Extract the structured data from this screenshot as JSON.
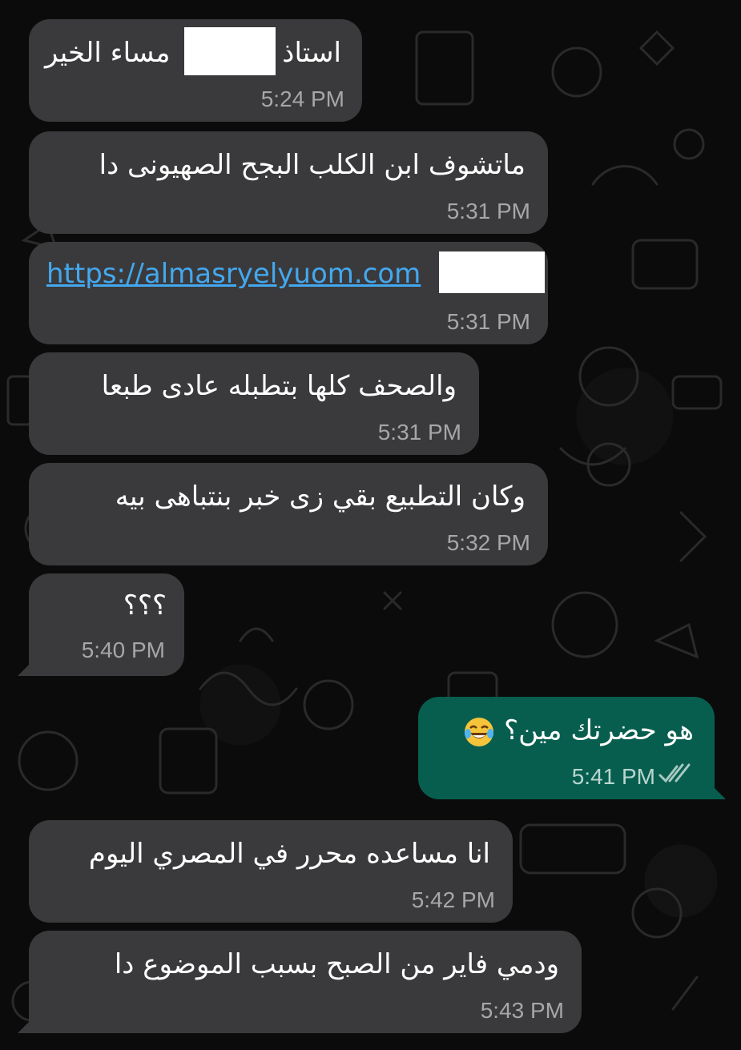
{
  "messages": [
    {
      "text_left": "مساء الخير",
      "text_right": "استاذ",
      "time": "5:24 PM",
      "direction": "in"
    },
    {
      "text": "ماتشوف ابن الكلب البجح  الصهيونى دا",
      "time": "5:31 PM",
      "direction": "in"
    },
    {
      "link": "https://almasryelyuom.com",
      "time": "5:31 PM",
      "direction": "in"
    },
    {
      "text": "والصحف كلها بتطبله عادى طبعا",
      "time": "5:31 PM",
      "direction": "in"
    },
    {
      "text": "وكان التطبيع بقي زى خبر بنتباهى بيه",
      "time": "5:32 PM",
      "direction": "in"
    },
    {
      "text": "؟؟؟",
      "time": "5:40 PM",
      "direction": "in"
    },
    {
      "text": "هو حضرتك مين؟",
      "emoji": "joy-emoji",
      "time": "5:41 PM",
      "direction": "out",
      "status": "read-double-check"
    },
    {
      "text": "انا مساعده محرر في المصري اليوم",
      "time": "5:42 PM",
      "direction": "in"
    },
    {
      "text": "ودمي فاير من الصبح بسبب الموضوع دا",
      "time": "5:43 PM",
      "direction": "in"
    }
  ],
  "colors": {
    "background": "#0b0b0b",
    "incoming_bubble": "#3a3a3c",
    "outgoing_bubble": "#075e4f",
    "link": "#43a8ef",
    "timestamp": "#a7a7a9"
  }
}
